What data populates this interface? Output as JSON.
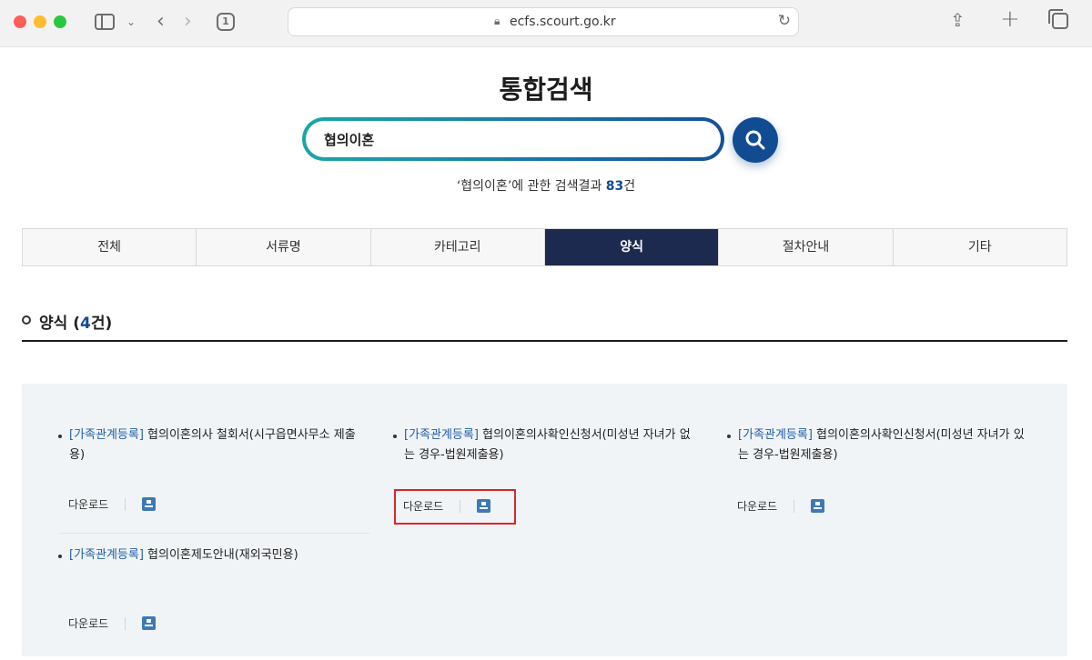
{
  "browser": {
    "url": "ecfs.scourt.go.kr"
  },
  "page": {
    "title": "통합검색",
    "search_value": "협의이혼",
    "summary_prefix": "‘협의이혼’에 관한 검색결과 ",
    "summary_count": "83",
    "summary_suffix": "건"
  },
  "tabs": [
    {
      "label": "전체"
    },
    {
      "label": "서류명"
    },
    {
      "label": "카테고리"
    },
    {
      "label": "양식"
    },
    {
      "label": "절차안내"
    },
    {
      "label": "기타"
    }
  ],
  "section": {
    "title_prefix": "양식 (",
    "count": "4",
    "title_suffix": "건)"
  },
  "results": [
    {
      "category": "[가족관계등록]",
      "title": " 협의이혼의사 철회서(시구읍면사무소 제출용)",
      "download_label": "다운로드"
    },
    {
      "category": "[가족관계등록]",
      "title": " 협의이혼의사확인신청서(미성년 자녀가 없는 경우-법원제출용)",
      "download_label": "다운로드"
    },
    {
      "category": "[가족관계등록]",
      "title": " 협의이혼의사확인신청서(미성년 자녀가 있는 경우-법원제출용)",
      "download_label": "다운로드"
    },
    {
      "category": "[가족관계등록]",
      "title": " 협의이혼제도안내(재외국민용)",
      "download_label": "다운로드"
    }
  ]
}
